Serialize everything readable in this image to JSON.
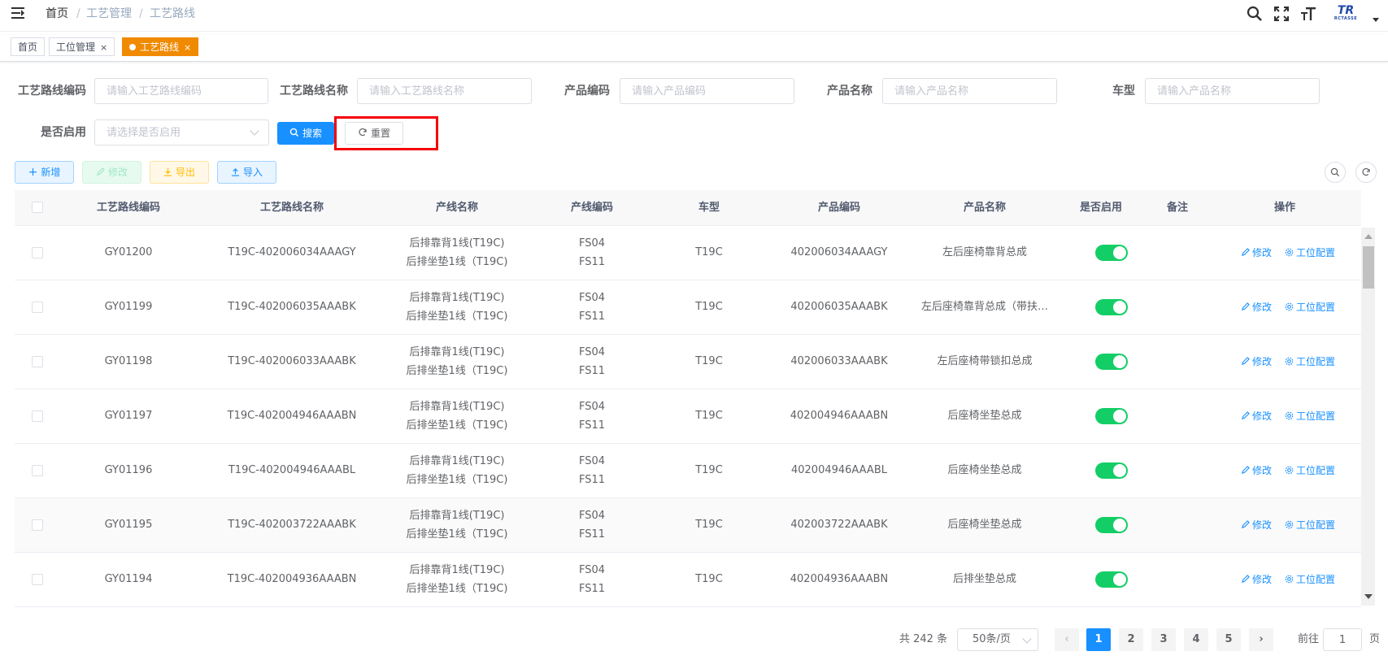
{
  "navbar": {
    "breadcrumb": [
      "首页",
      "工艺管理",
      "工艺路线"
    ],
    "breadcrumb_sep": "/",
    "logo_text": "TR",
    "logo_sub": "RCTASSE"
  },
  "tags": [
    {
      "label": "首页",
      "closable": false,
      "active": false
    },
    {
      "label": "工位管理",
      "closable": true,
      "active": false
    },
    {
      "label": "工艺路线",
      "closable": true,
      "active": true
    }
  ],
  "tag_close": "×",
  "search_form": {
    "fields": [
      {
        "label": "工艺路线编码",
        "placeholder": "请输入工艺路线编码"
      },
      {
        "label": "工艺路线名称",
        "placeholder": "请输入工艺路线名称"
      },
      {
        "label": "产品编码",
        "placeholder": "请输入产品编码"
      },
      {
        "label": "产品名称",
        "placeholder": "请输入产品名称"
      },
      {
        "label": "车型",
        "placeholder": "请输入产品名称"
      }
    ],
    "enabled": {
      "label": "是否启用",
      "placeholder": "请选择是否启用"
    },
    "search_button": "搜索",
    "reset_button": "重置"
  },
  "toolbar": {
    "add": "新增",
    "edit": "修改",
    "export": "导出",
    "import": "导入"
  },
  "table": {
    "columns": [
      "工艺路线编码",
      "工艺路线名称",
      "产线名称",
      "产线编码",
      "车型",
      "产品编码",
      "产品名称",
      "是否启用",
      "备注",
      "操作"
    ],
    "rows": [
      {
        "code": "GY01200",
        "name": "T19C-402006034AAAGY",
        "line1": "后排靠背1线(T19C)",
        "line2": "后排坐垫1线（T19C)",
        "lc1": "FS04",
        "lc2": "FS11",
        "car": "T19C",
        "pcode": "402006034AAAGY",
        "pname": "左后座椅靠背总成",
        "enabled": true,
        "remark": ""
      },
      {
        "code": "GY01199",
        "name": "T19C-402006035AAABK",
        "line1": "后排靠背1线(T19C)",
        "line2": "后排坐垫1线（T19C)",
        "lc1": "FS04",
        "lc2": "FS11",
        "car": "T19C",
        "pcode": "402006035AAABK",
        "pname": "左后座椅靠背总成（带扶…",
        "enabled": true,
        "remark": ""
      },
      {
        "code": "GY01198",
        "name": "T19C-402006033AAABK",
        "line1": "后排靠背1线(T19C)",
        "line2": "后排坐垫1线（T19C)",
        "lc1": "FS04",
        "lc2": "FS11",
        "car": "T19C",
        "pcode": "402006033AAABK",
        "pname": "左后座椅带锁扣总成",
        "enabled": true,
        "remark": ""
      },
      {
        "code": "GY01197",
        "name": "T19C-402004946AAABN",
        "line1": "后排靠背1线(T19C)",
        "line2": "后排坐垫1线（T19C)",
        "lc1": "FS04",
        "lc2": "FS11",
        "car": "T19C",
        "pcode": "402004946AAABN",
        "pname": "后座椅坐垫总成",
        "enabled": true,
        "remark": ""
      },
      {
        "code": "GY01196",
        "name": "T19C-402004946AAABL",
        "line1": "后排靠背1线(T19C)",
        "line2": "后排坐垫1线（T19C)",
        "lc1": "FS04",
        "lc2": "FS11",
        "car": "T19C",
        "pcode": "402004946AAABL",
        "pname": "后座椅坐垫总成",
        "enabled": true,
        "remark": ""
      },
      {
        "code": "GY01195",
        "name": "T19C-402003722AAABK",
        "line1": "后排靠背1线(T19C)",
        "line2": "后排坐垫1线（T19C)",
        "lc1": "FS04",
        "lc2": "FS11",
        "car": "T19C",
        "pcode": "402003722AAABK",
        "pname": "后座椅坐垫总成",
        "enabled": true,
        "remark": ""
      },
      {
        "code": "GY01194",
        "name": "T19C-402004936AAABN",
        "line1": "后排靠背1线(T19C)",
        "line2": "后排坐垫1线（T19C)",
        "lc1": "FS04",
        "lc2": "FS11",
        "car": "T19C",
        "pcode": "402004936AAABN",
        "pname": "后排坐垫总成",
        "enabled": true,
        "remark": ""
      }
    ],
    "action_edit": "修改",
    "action_station": "工位配置"
  },
  "pagination": {
    "total_text": "共 242 条",
    "page_size": "50条/页",
    "pages": [
      "1",
      "2",
      "3",
      "4",
      "5"
    ],
    "current": "1",
    "goto_prefix": "前往",
    "goto_value": "1",
    "goto_suffix": "页"
  },
  "colors": {
    "primary": "#1890ff",
    "active_tag": "#f08a00",
    "switch_on": "#13ce66",
    "highlight": "#f5000a"
  }
}
